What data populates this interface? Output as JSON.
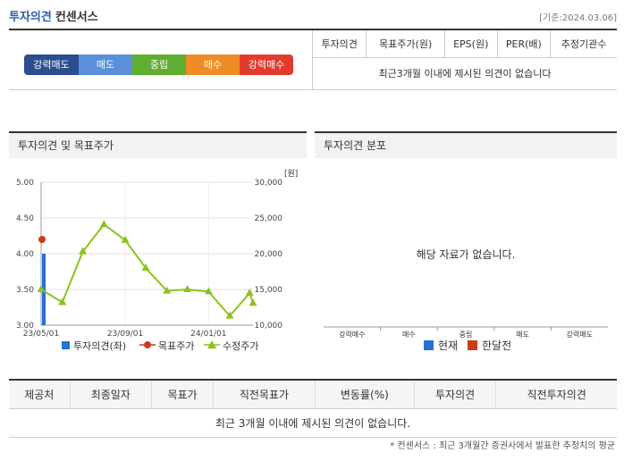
{
  "header": {
    "title_main": "투자의견",
    "title_sub": "컨센서스",
    "date": "[기준:2024.03.06]"
  },
  "scale": {
    "labels": [
      "강력매도",
      "매도",
      "중립",
      "매수",
      "강력매수"
    ],
    "colors": [
      "#2c4d8e",
      "#5a8fd9",
      "#5fae2f",
      "#f08c26",
      "#e23b2c"
    ]
  },
  "consensus_table": {
    "headers": [
      "투자의견",
      "목표주가(원)",
      "EPS(원)",
      "PER(배)",
      "추정기관수"
    ],
    "empty_message": "최근3개월 이내에 제시된 의견이 없습니다"
  },
  "panels": {
    "left_title": "투자의견 및 목표주가",
    "right_title": "투자의견 분포",
    "right_empty": "해당 자료가 없습니다.",
    "right_categories": [
      "강력매수",
      "매수",
      "중립",
      "매도",
      "강력매도"
    ],
    "right_legend": [
      "현재",
      "한달전"
    ]
  },
  "bottom_table": {
    "headers": [
      "제공처",
      "최종일자",
      "목표가",
      "직전목표가",
      "변동률(%)",
      "투자의견",
      "직전투자의견"
    ],
    "empty_message": "최근 3개월 이내에 제시된 의견이 없습니다."
  },
  "footnote": "* 컨센서스 : 최근 3개월간 증권사에서 발표한 추정치의 평균",
  "chart_data": {
    "type": "line",
    "left_axis": {
      "ticks": [
        "5.00",
        "4.50",
        "4.00",
        "3.50",
        "3.00"
      ],
      "ylim": [
        3.0,
        5.0
      ]
    },
    "right_axis": {
      "unit": "[원]",
      "ticks": [
        "30,000",
        "25,000",
        "20,000",
        "15,000",
        "10,000"
      ],
      "ylim": [
        10000,
        30000
      ]
    },
    "x_ticks": [
      "23/05/01",
      "23/09/01",
      "24/01/01"
    ],
    "legend": [
      "투자의견(좌)",
      "목표주가",
      "수정주가"
    ],
    "series": [
      {
        "name": "수정주가",
        "color": "#8dc21f",
        "x": [
          "2023-05-01",
          "2023-06-01",
          "2023-07-01",
          "2023-08-01",
          "2023-09-01",
          "2023-10-01",
          "2023-11-01",
          "2023-12-01",
          "2024-01-01",
          "2024-02-01",
          "2024-03-01",
          "2024-03-06"
        ],
        "values": [
          15000,
          13200,
          20300,
          24100,
          21900,
          18000,
          14800,
          15000,
          14700,
          11300,
          14500,
          13100
        ]
      },
      {
        "name": "목표주가",
        "color": "#cc3a1a",
        "x": [
          "2023-05-01"
        ],
        "values": [
          22000
        ]
      },
      {
        "name": "투자의견(좌)",
        "color": "#2a6fd6",
        "x": [
          "2023-05-01"
        ],
        "values": [
          4.0
        ]
      }
    ]
  }
}
